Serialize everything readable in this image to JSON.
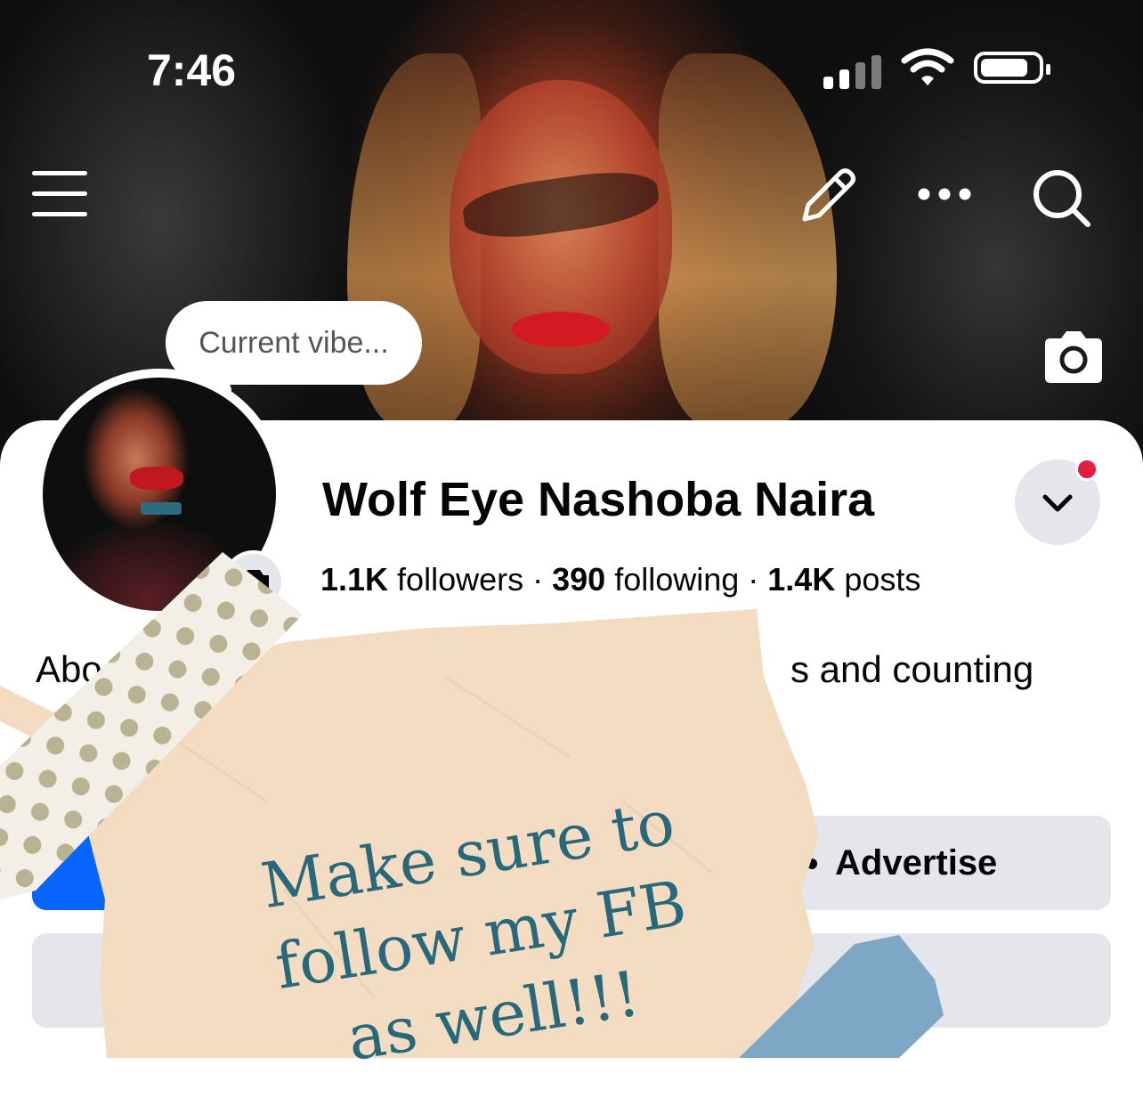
{
  "status_bar": {
    "time": "7:46",
    "signal_icon": "signal-bars-icon",
    "wifi_icon": "wifi-icon",
    "battery_icon": "battery-icon"
  },
  "header": {
    "menu_icon": "hamburger-menu-icon",
    "edit_icon": "pencil-icon",
    "more_icon": "more-dots-icon",
    "search_icon": "search-icon"
  },
  "cover": {
    "camera_icon": "camera-icon"
  },
  "note_bubble": {
    "text": "Current vibe..."
  },
  "profile": {
    "name": "Wolf Eye Nashoba Naira",
    "followers_count": "1.1K",
    "followers_label": " followers",
    "following_count": "390",
    "following_label": " following",
    "posts_count": "1.4K",
    "posts_label": " posts",
    "separator": " · ",
    "bio_left": "Abo",
    "bio_right": "s and counting",
    "avatar_camera_icon": "camera-icon",
    "dropdown_icon": "chevron-down-icon",
    "notification_dot_color": "#e41e3f"
  },
  "buttons": {
    "advertise_label": "Advertise",
    "primary_color": "#0866ff",
    "secondary_color": "#e4e6eb"
  },
  "overlay": {
    "text_line1": "Make sure to",
    "text_line2": "follow my FB",
    "text_line3": "as well!!!",
    "text_color": "#27687a",
    "paper_color": "#f3dcc2",
    "tape_dots_color": "#b9b394",
    "tape_blue_color": "#7ea7c6"
  }
}
